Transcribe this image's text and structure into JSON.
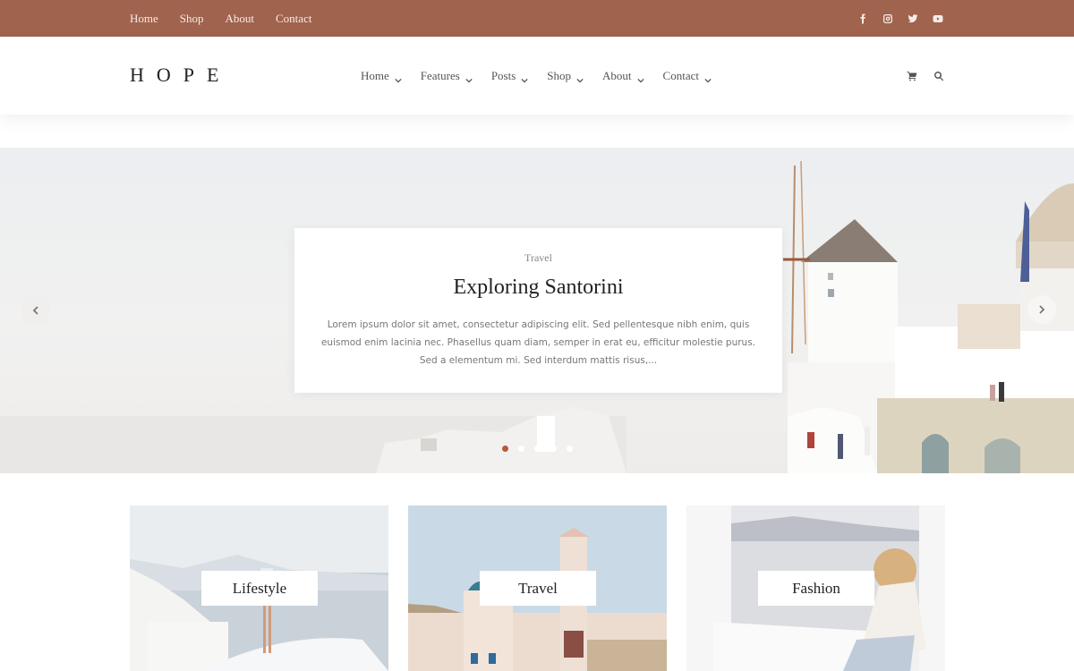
{
  "topbar": {
    "links": [
      "Home",
      "Shop",
      "About",
      "Contact"
    ],
    "social": [
      {
        "name": "facebook-icon"
      },
      {
        "name": "instagram-icon"
      },
      {
        "name": "twitter-icon"
      },
      {
        "name": "youtube-icon"
      }
    ],
    "color": "#a0634e"
  },
  "header": {
    "logo": "HOPE",
    "nav": [
      {
        "label": "Home"
      },
      {
        "label": "Features"
      },
      {
        "label": "Posts"
      },
      {
        "label": "Shop"
      },
      {
        "label": "About"
      },
      {
        "label": "Contact"
      }
    ],
    "icons": [
      "cart-icon",
      "search-icon"
    ]
  },
  "hero": {
    "category": "Travel",
    "title": "Exploring Santorini",
    "excerpt": "Lorem ipsum dolor sit amet, consectetur adipiscing elit. Sed pellentesque nibh enim, quis euismod enim lacinia nec. Phasellus quam diam, semper in erat eu, efficitur molestie purus. Sed a elementum mi. Sed interdum mattis risus,...",
    "slides_total": 5,
    "active_slide": 1,
    "accent": "#b45a3c"
  },
  "categories": [
    {
      "label": "Lifestyle"
    },
    {
      "label": "Travel"
    },
    {
      "label": "Fashion"
    }
  ]
}
